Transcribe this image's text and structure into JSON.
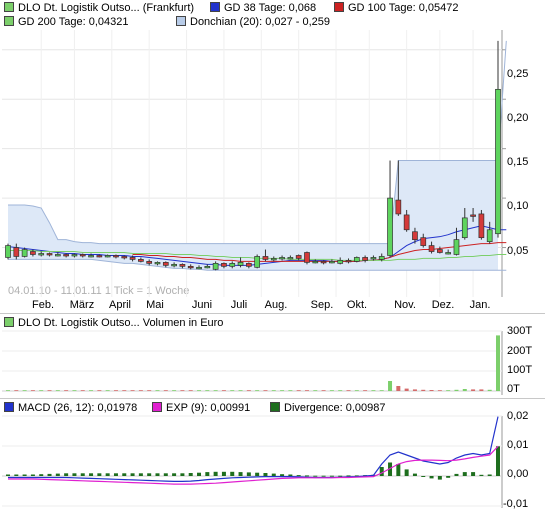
{
  "price_panel": {
    "legend": [
      {
        "label": "DLO Dt. Logistik Outso... (Frankfurt)",
        "color": "#7ccf6b"
      },
      {
        "label": "GD 38 Tage: 0,068",
        "color": "#2233cc"
      },
      {
        "label": "GD 100 Tage: 0,05472",
        "color": "#cc2222"
      },
      {
        "label": "GD 200 Tage: 0,04321",
        "color": "#7ccf6b"
      },
      {
        "label": "Donchian (20): 0,027 - 0,259",
        "color": "#b8cce8"
      }
    ],
    "watermark": "04.01.10 - 11.01.11   1 Tick = 1 Woche",
    "months": [
      "Feb.",
      "März",
      "April",
      "Mai",
      "Juni",
      "Juli",
      "Aug.",
      "Sep.",
      "Okt.",
      "Nov.",
      "Dez.",
      "Jan."
    ],
    "y_ticks": [
      "0,25",
      "0,20",
      "0,15",
      "0,10",
      "0,05"
    ]
  },
  "volume_panel": {
    "legend": {
      "label": "DLO Dt. Logistik Outso... Volumen in Euro",
      "color": "#7ccf6b"
    },
    "y_ticks": [
      "300T",
      "200T",
      "100T",
      "0T"
    ]
  },
  "macd_panel": {
    "legend": [
      {
        "label": "MACD (26, 12): 0,01978",
        "color": "#2233cc"
      },
      {
        "label": "EXP (9): 0,00991",
        "color": "#e020d0"
      },
      {
        "label": "Divergence: 0,00987",
        "color": "#1e6e1e"
      }
    ],
    "y_ticks": [
      "0,02",
      "0,01",
      "0,00",
      "-0,01"
    ]
  },
  "chart_data": [
    {
      "type": "candlestick",
      "title": "DLO Dt. Logistik Outso... (Frankfurt)",
      "x_unit": "week",
      "ylim": [
        0.0,
        0.27
      ],
      "candles": [
        {
          "o": 0.04,
          "c": 0.052,
          "h": 0.054,
          "l": 0.038
        },
        {
          "o": 0.05,
          "c": 0.041,
          "h": 0.054,
          "l": 0.038
        },
        {
          "o": 0.041,
          "c": 0.048,
          "h": 0.05,
          "l": 0.04
        },
        {
          "o": 0.046,
          "c": 0.043,
          "h": 0.048,
          "l": 0.041
        },
        {
          "o": 0.043,
          "c": 0.044,
          "h": 0.046,
          "l": 0.041
        },
        {
          "o": 0.044,
          "c": 0.043,
          "h": 0.045,
          "l": 0.041
        },
        {
          "o": 0.043,
          "c": 0.043,
          "h": 0.045,
          "l": 0.041
        },
        {
          "o": 0.043,
          "c": 0.042,
          "h": 0.044,
          "l": 0.04
        },
        {
          "o": 0.042,
          "c": 0.043,
          "h": 0.044,
          "l": 0.04
        },
        {
          "o": 0.043,
          "c": 0.042,
          "h": 0.044,
          "l": 0.04
        },
        {
          "o": 0.042,
          "c": 0.042,
          "h": 0.044,
          "l": 0.04
        },
        {
          "o": 0.042,
          "c": 0.041,
          "h": 0.043,
          "l": 0.04
        },
        {
          "o": 0.041,
          "c": 0.042,
          "h": 0.043,
          "l": 0.04
        },
        {
          "o": 0.042,
          "c": 0.041,
          "h": 0.043,
          "l": 0.039
        },
        {
          "o": 0.041,
          "c": 0.04,
          "h": 0.042,
          "l": 0.038
        },
        {
          "o": 0.04,
          "c": 0.038,
          "h": 0.042,
          "l": 0.036
        },
        {
          "o": 0.038,
          "c": 0.036,
          "h": 0.04,
          "l": 0.035
        },
        {
          "o": 0.036,
          "c": 0.034,
          "h": 0.038,
          "l": 0.032
        },
        {
          "o": 0.034,
          "c": 0.035,
          "h": 0.036,
          "l": 0.032
        },
        {
          "o": 0.035,
          "c": 0.032,
          "h": 0.036,
          "l": 0.03
        },
        {
          "o": 0.032,
          "c": 0.033,
          "h": 0.035,
          "l": 0.03
        },
        {
          "o": 0.033,
          "c": 0.031,
          "h": 0.034,
          "l": 0.029
        },
        {
          "o": 0.031,
          "c": 0.03,
          "h": 0.033,
          "l": 0.028
        },
        {
          "o": 0.03,
          "c": 0.03,
          "h": 0.032,
          "l": 0.028
        },
        {
          "o": 0.03,
          "c": 0.031,
          "h": 0.033,
          "l": 0.029
        },
        {
          "o": 0.028,
          "c": 0.034,
          "h": 0.036,
          "l": 0.027
        },
        {
          "o": 0.034,
          "c": 0.031,
          "h": 0.035,
          "l": 0.029
        },
        {
          "o": 0.031,
          "c": 0.034,
          "h": 0.036,
          "l": 0.029
        },
        {
          "o": 0.032,
          "c": 0.035,
          "h": 0.04,
          "l": 0.03
        },
        {
          "o": 0.034,
          "c": 0.031,
          "h": 0.035,
          "l": 0.029
        },
        {
          "o": 0.03,
          "c": 0.041,
          "h": 0.043,
          "l": 0.029
        },
        {
          "o": 0.041,
          "c": 0.038,
          "h": 0.048,
          "l": 0.036
        },
        {
          "o": 0.038,
          "c": 0.039,
          "h": 0.041,
          "l": 0.036
        },
        {
          "o": 0.039,
          "c": 0.04,
          "h": 0.042,
          "l": 0.037
        },
        {
          "o": 0.04,
          "c": 0.04,
          "h": 0.042,
          "l": 0.038
        },
        {
          "o": 0.042,
          "c": 0.039,
          "h": 0.043,
          "l": 0.037
        },
        {
          "o": 0.045,
          "c": 0.035,
          "h": 0.046,
          "l": 0.033
        },
        {
          "o": 0.035,
          "c": 0.036,
          "h": 0.038,
          "l": 0.034
        },
        {
          "o": 0.036,
          "c": 0.035,
          "h": 0.037,
          "l": 0.033
        },
        {
          "o": 0.035,
          "c": 0.036,
          "h": 0.038,
          "l": 0.034
        },
        {
          "o": 0.034,
          "c": 0.037,
          "h": 0.04,
          "l": 0.033
        },
        {
          "o": 0.037,
          "c": 0.036,
          "h": 0.039,
          "l": 0.034
        },
        {
          "o": 0.036,
          "c": 0.04,
          "h": 0.041,
          "l": 0.035
        },
        {
          "o": 0.04,
          "c": 0.037,
          "h": 0.042,
          "l": 0.035
        },
        {
          "o": 0.039,
          "c": 0.04,
          "h": 0.042,
          "l": 0.037
        },
        {
          "o": 0.038,
          "c": 0.041,
          "h": 0.044,
          "l": 0.036
        },
        {
          "o": 0.042,
          "c": 0.1,
          "h": 0.138,
          "l": 0.04
        },
        {
          "o": 0.098,
          "c": 0.084,
          "h": 0.138,
          "l": 0.082
        },
        {
          "o": 0.083,
          "c": 0.068,
          "h": 0.088,
          "l": 0.066
        },
        {
          "o": 0.066,
          "c": 0.058,
          "h": 0.07,
          "l": 0.054
        },
        {
          "o": 0.06,
          "c": 0.052,
          "h": 0.064,
          "l": 0.05
        },
        {
          "o": 0.052,
          "c": 0.046,
          "h": 0.056,
          "l": 0.044
        },
        {
          "o": 0.048,
          "c": 0.045,
          "h": 0.051,
          "l": 0.044
        },
        {
          "o": 0.045,
          "c": 0.045,
          "h": 0.048,
          "l": 0.043
        },
        {
          "o": 0.043,
          "c": 0.058,
          "h": 0.07,
          "l": 0.042
        },
        {
          "o": 0.06,
          "c": 0.08,
          "h": 0.09,
          "l": 0.058
        },
        {
          "o": 0.083,
          "c": 0.082,
          "h": 0.09,
          "l": 0.076
        },
        {
          "o": 0.084,
          "c": 0.06,
          "h": 0.088,
          "l": 0.058
        },
        {
          "o": 0.056,
          "c": 0.068,
          "h": 0.076,
          "l": 0.054
        },
        {
          "o": 0.064,
          "c": 0.21,
          "h": 0.259,
          "l": 0.06
        }
      ],
      "series": [
        {
          "name": "GD 38 Tage",
          "color": "#2233cc",
          "values": [
            0.051,
            0.05,
            0.049,
            0.048,
            0.047,
            0.046,
            0.045,
            0.044,
            0.044,
            0.043,
            0.043,
            0.043,
            0.042,
            0.042,
            0.042,
            0.041,
            0.041,
            0.04,
            0.039,
            0.038,
            0.037,
            0.036,
            0.035,
            0.034,
            0.033,
            0.033,
            0.032,
            0.032,
            0.032,
            0.032,
            0.033,
            0.034,
            0.035,
            0.036,
            0.037,
            0.037,
            0.037,
            0.037,
            0.037,
            0.036,
            0.036,
            0.036,
            0.036,
            0.037,
            0.037,
            0.038,
            0.04,
            0.046,
            0.052,
            0.056,
            0.059,
            0.06,
            0.061,
            0.063,
            0.066,
            0.068,
            0.07,
            0.072,
            0.07,
            0.068,
            0.068
          ]
        },
        {
          "name": "GD 100 Tage",
          "color": "#cc2222",
          "values": [
            null,
            null,
            null,
            null,
            null,
            null,
            null,
            null,
            null,
            null,
            null,
            null,
            null,
            null,
            null,
            0.043,
            0.043,
            0.042,
            0.042,
            0.041,
            0.041,
            0.04,
            0.04,
            0.039,
            0.038,
            0.038,
            0.037,
            0.037,
            0.036,
            0.036,
            0.036,
            0.036,
            0.036,
            0.036,
            0.036,
            0.036,
            0.036,
            0.036,
            0.036,
            0.036,
            0.036,
            0.036,
            0.036,
            0.037,
            0.037,
            0.038,
            0.04,
            0.043,
            0.045,
            0.047,
            0.048,
            0.048,
            0.049,
            0.05,
            0.051,
            0.052,
            0.053,
            0.054,
            0.054,
            0.055,
            0.055
          ]
        },
        {
          "name": "GD 200 Tage",
          "color": "#7ccf6b",
          "values": [
            0.047,
            0.047,
            0.047,
            0.047,
            0.046,
            0.046,
            0.046,
            0.046,
            0.046,
            0.045,
            0.045,
            0.045,
            0.045,
            0.045,
            0.045,
            0.044,
            0.044,
            0.044,
            0.044,
            0.044,
            0.043,
            0.043,
            0.043,
            0.042,
            0.042,
            0.041,
            0.041,
            0.04,
            0.04,
            0.04,
            0.039,
            0.039,
            0.039,
            0.039,
            0.038,
            0.038,
            0.038,
            0.038,
            0.038,
            0.038,
            0.037,
            0.037,
            0.037,
            0.037,
            0.037,
            0.037,
            0.037,
            0.038,
            0.038,
            0.038,
            0.039,
            0.039,
            0.039,
            0.04,
            0.04,
            0.041,
            0.041,
            0.042,
            0.042,
            0.043,
            0.043
          ]
        }
      ],
      "donchian_upper": [
        0.093,
        0.093,
        0.093,
        0.092,
        0.09,
        0.075,
        0.058,
        0.058,
        0.056,
        0.055,
        0.055,
        0.054,
        0.054,
        0.054,
        0.054,
        0.054,
        0.054,
        0.054,
        0.054,
        0.054,
        0.054,
        0.054,
        0.054,
        0.054,
        0.054,
        0.054,
        0.054,
        0.054,
        0.054,
        0.054,
        0.054,
        0.054,
        0.054,
        0.054,
        0.054,
        0.054,
        0.054,
        0.054,
        0.054,
        0.054,
        0.054,
        0.054,
        0.054,
        0.054,
        0.054,
        0.054,
        0.054,
        0.138,
        0.138,
        0.138,
        0.138,
        0.138,
        0.138,
        0.138,
        0.138,
        0.138,
        0.138,
        0.138,
        0.138,
        0.138,
        0.259
      ],
      "donchian_lower": [
        0.038,
        0.038,
        0.038,
        0.038,
        0.038,
        0.038,
        0.038,
        0.038,
        0.038,
        0.038,
        0.038,
        0.037,
        0.036,
        0.035,
        0.034,
        0.034,
        0.033,
        0.032,
        0.031,
        0.03,
        0.029,
        0.029,
        0.028,
        0.028,
        0.027,
        0.027,
        0.027,
        0.027,
        0.027,
        0.027,
        0.027,
        0.027,
        0.027,
        0.027,
        0.027,
        0.027,
        0.027,
        0.027,
        0.027,
        0.027,
        0.027,
        0.027,
        0.027,
        0.027,
        0.027,
        0.027,
        0.027,
        0.027,
        0.027,
        0.027,
        0.027,
        0.027,
        0.027,
        0.027,
        0.027,
        0.027,
        0.027,
        0.027,
        0.027,
        0.027,
        0.027
      ]
    },
    {
      "type": "bar",
      "title": "DLO Dt. Logistik Outso... Volumen in Euro",
      "ylim": [
        0,
        300
      ],
      "y_unit": "T",
      "values": [
        4,
        1,
        1,
        1,
        1,
        0,
        0,
        1,
        0,
        0,
        0,
        1,
        0,
        0,
        0,
        1,
        1,
        1,
        0,
        0,
        1,
        1,
        1,
        1,
        1,
        1,
        1,
        2,
        1,
        1,
        2,
        2,
        1,
        1,
        1,
        1,
        2,
        1,
        1,
        1,
        2,
        1,
        2,
        1,
        2,
        3,
        50,
        25,
        12,
        8,
        6,
        5,
        4,
        4,
        6,
        10,
        8,
        8,
        6,
        278
      ]
    },
    {
      "type": "line",
      "title": "MACD (26, 12)",
      "ylim": [
        -0.01,
        0.02
      ],
      "series": [
        {
          "name": "MACD (26, 12)",
          "color": "#2233cc",
          "values": [
            -0.0005,
            -0.0005,
            -0.0005,
            -0.0005,
            -0.0005,
            -0.0005,
            -0.0005,
            -0.0005,
            -0.0006,
            -0.0007,
            -0.0008,
            -0.0009,
            -0.001,
            -0.0011,
            -0.0012,
            -0.0013,
            -0.0014,
            -0.0015,
            -0.0016,
            -0.0017,
            -0.0018,
            -0.0018,
            -0.0017,
            -0.0015,
            -0.0012,
            -0.001,
            -0.0008,
            -0.0006,
            -0.0005,
            -0.0004,
            -0.0003,
            -0.0002,
            -0.0002,
            -0.0002,
            -0.0002,
            -0.0003,
            -0.0004,
            -0.0005,
            -0.0005,
            -0.0005,
            -0.0004,
            -0.0003,
            -0.0002,
            0.0,
            0.0002,
            0.004,
            0.007,
            0.008,
            0.007,
            0.006,
            0.005,
            0.0045,
            0.004,
            0.0045,
            0.006,
            0.007,
            0.0075,
            0.007,
            0.0075,
            0.0198
          ]
        },
        {
          "name": "EXP (9)",
          "color": "#e020d0",
          "values": [
            -0.001,
            -0.001,
            -0.001,
            -0.001,
            -0.0011,
            -0.0012,
            -0.0013,
            -0.0014,
            -0.0015,
            -0.0016,
            -0.0017,
            -0.0018,
            -0.0019,
            -0.002,
            -0.0021,
            -0.0022,
            -0.0023,
            -0.0024,
            -0.0025,
            -0.0026,
            -0.0027,
            -0.0027,
            -0.0027,
            -0.0026,
            -0.0025,
            -0.0024,
            -0.0022,
            -0.002,
            -0.0018,
            -0.0016,
            -0.0014,
            -0.0012,
            -0.001,
            -0.0008,
            -0.0007,
            -0.0006,
            -0.0006,
            -0.0006,
            -0.0006,
            -0.0006,
            -0.0005,
            -0.0005,
            -0.0004,
            -0.0003,
            -0.0002,
            0.001,
            0.0025,
            0.004,
            0.0048,
            0.0052,
            0.0053,
            0.0053,
            0.0052,
            0.0051,
            0.0053,
            0.0057,
            0.0062,
            0.0066,
            0.007,
            0.0099
          ]
        },
        {
          "name": "Divergence",
          "color": "#1e6e1e",
          "kind": "bar",
          "values": [
            0.0005,
            0.0005,
            0.0005,
            0.0005,
            0.0006,
            0.0007,
            0.0008,
            0.0009,
            0.0009,
            0.0009,
            0.0009,
            0.0009,
            0.0009,
            0.0009,
            0.0009,
            0.0009,
            0.0009,
            0.0009,
            0.0009,
            0.0009,
            0.0009,
            0.0009,
            0.001,
            0.0011,
            0.0013,
            0.0014,
            0.0014,
            0.0014,
            0.0013,
            0.0012,
            0.0011,
            0.001,
            0.0008,
            0.0006,
            0.0005,
            0.0003,
            0.0002,
            0.0001,
            0.0001,
            0.0001,
            0.0001,
            0.0002,
            0.0002,
            0.0003,
            0.0004,
            0.003,
            0.0045,
            0.004,
            0.0022,
            0.0008,
            -0.0003,
            -0.0008,
            -0.0012,
            -0.0006,
            0.0007,
            0.0013,
            0.0013,
            0.0004,
            0.0005,
            0.0099
          ]
        }
      ]
    }
  ]
}
